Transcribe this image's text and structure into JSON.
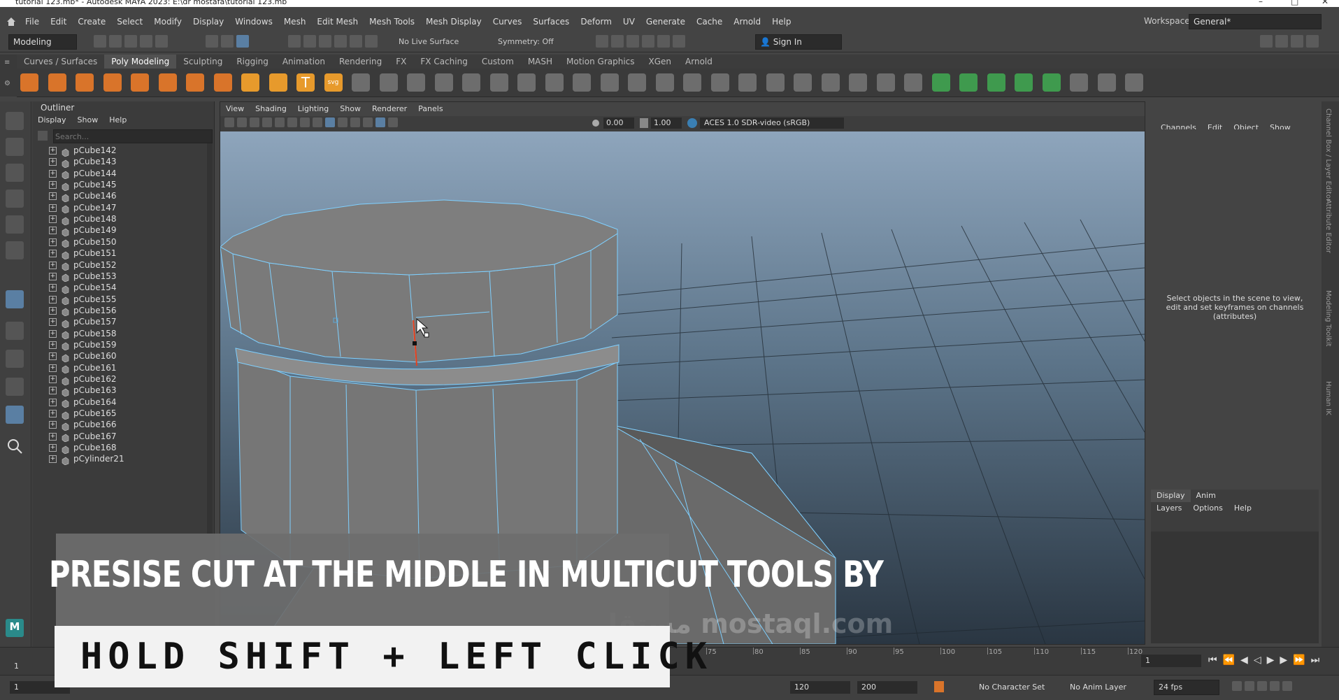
{
  "titlebar": {
    "title": "tutorial 123.mb* - Autodesk MAYA 2023: E:\\dr mostafa\\tutorial 123.mb",
    "minimize": "–",
    "maximize": "□",
    "close": "✕"
  },
  "menubar": {
    "items": [
      "File",
      "Edit",
      "Create",
      "Select",
      "Modify",
      "Display",
      "Windows",
      "Mesh",
      "Edit Mesh",
      "Mesh Tools",
      "Mesh Display",
      "Curves",
      "Surfaces",
      "Deform",
      "UV",
      "Generate",
      "Cache",
      "Arnold",
      "Help"
    ],
    "workspace_label": "Workspace:",
    "workspace_value": "General*"
  },
  "statusline": {
    "mode": "Modeling",
    "live_surface": "No Live Surface",
    "symmetry": "Symmetry: Off",
    "sign_in": "Sign In"
  },
  "shelf": {
    "tabs": [
      "Curves / Surfaces",
      "Poly Modeling",
      "Sculpting",
      "Rigging",
      "Animation",
      "Rendering",
      "FX",
      "FX Caching",
      "Custom",
      "MASH",
      "Motion Graphics",
      "XGen",
      "Arnold"
    ],
    "active": "Poly Modeling"
  },
  "outliner": {
    "title": "Outliner",
    "menu": [
      "Display",
      "Show",
      "Help"
    ],
    "search_placeholder": "Search...",
    "items": [
      "pCube142",
      "pCube143",
      "pCube144",
      "pCube145",
      "pCube146",
      "pCube147",
      "pCube148",
      "pCube149",
      "pCube150",
      "pCube151",
      "pCube152",
      "pCube153",
      "pCube154",
      "pCube155",
      "pCube156",
      "pCube157",
      "pCube158",
      "pCube159",
      "pCube160",
      "pCube161",
      "pCube162",
      "pCube163",
      "pCube164",
      "pCube165",
      "pCube166",
      "pCube167",
      "pCube168",
      "pCylinder21"
    ]
  },
  "viewport": {
    "menu": [
      "View",
      "Shading",
      "Lighting",
      "Show",
      "Renderer",
      "Panels"
    ],
    "exposure": "0.00",
    "gamma": "1.00",
    "colorspace": "ACES 1.0 SDR-video (sRGB)"
  },
  "channelbox": {
    "menu": [
      "Channels",
      "Edit",
      "Object",
      "Show"
    ],
    "hint": "Select objects in the scene to view, edit and set keyframes on channels (attributes)",
    "side_tabs": [
      "Channel Box / Layer Editor",
      "Attribute Editor",
      "Modeling Toolkit",
      "Human IK"
    ],
    "layer_tabs": [
      "Display",
      "Anim"
    ],
    "layer_menu": [
      "Layers",
      "Options",
      "Help"
    ]
  },
  "timeline": {
    "ticks": [
      "75",
      "80",
      "85",
      "90",
      "95",
      "100",
      "105",
      "110",
      "115",
      "120"
    ],
    "current_frame_left": "1",
    "current_frame_right": "1",
    "range_start": "1",
    "range_end_a": "120",
    "range_end_b": "200",
    "playback_end": "120",
    "character_set": "No Character Set",
    "anim_layer": "No Anim Layer",
    "fps": "24 fps"
  },
  "caption": {
    "line1": "PRESISE CUT AT THE MIDDLE IN MULTICUT TOOLS BY",
    "line2": "HOLD SHIFT + LEFT CLICK"
  },
  "watermark": "مستقل mostaql.com",
  "colors": {
    "accent": "#5aa8d8",
    "wire": "#7fd0ff",
    "cut": "#e8401c"
  }
}
